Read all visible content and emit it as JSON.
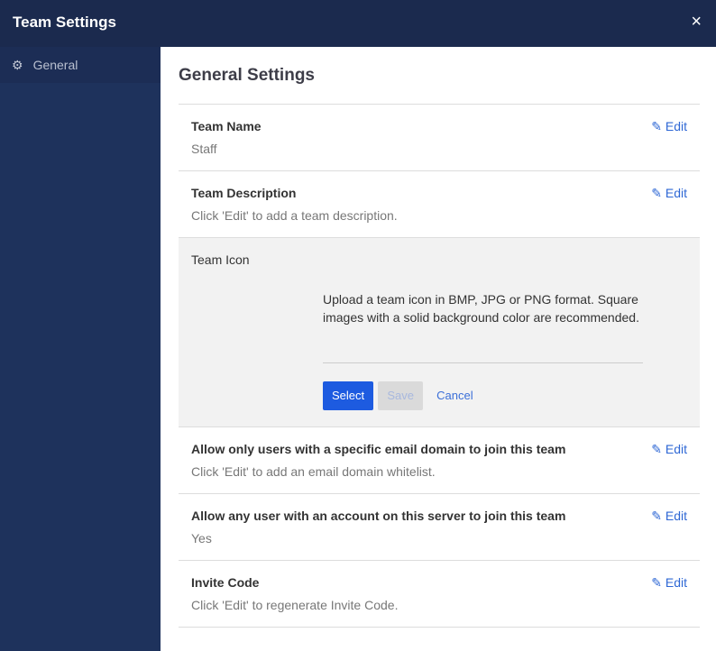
{
  "header": {
    "title": "Team Settings",
    "close": "×"
  },
  "sidebar": {
    "items": [
      {
        "label": "General",
        "icon": "gear-icon"
      }
    ]
  },
  "main": {
    "title": "General Settings",
    "edit_label": "Edit",
    "sections": [
      {
        "label": "Team Name",
        "value": "Staff"
      },
      {
        "label": "Team Description",
        "value": "Click 'Edit' to add a team description."
      },
      {
        "label": "Allow only users with a specific email domain to join this team",
        "value": "Click 'Edit' to add an email domain whitelist."
      },
      {
        "label": "Allow any user with an account on this server to join this team",
        "value": "Yes"
      },
      {
        "label": "Invite Code",
        "value": "Click 'Edit' to regenerate Invite Code."
      }
    ],
    "team_icon": {
      "label": "Team Icon",
      "help": "Upload a team icon in BMP, JPG or PNG format. Square images with a solid background color are recommended.",
      "select": "Select",
      "save": "Save",
      "cancel": "Cancel"
    }
  }
}
